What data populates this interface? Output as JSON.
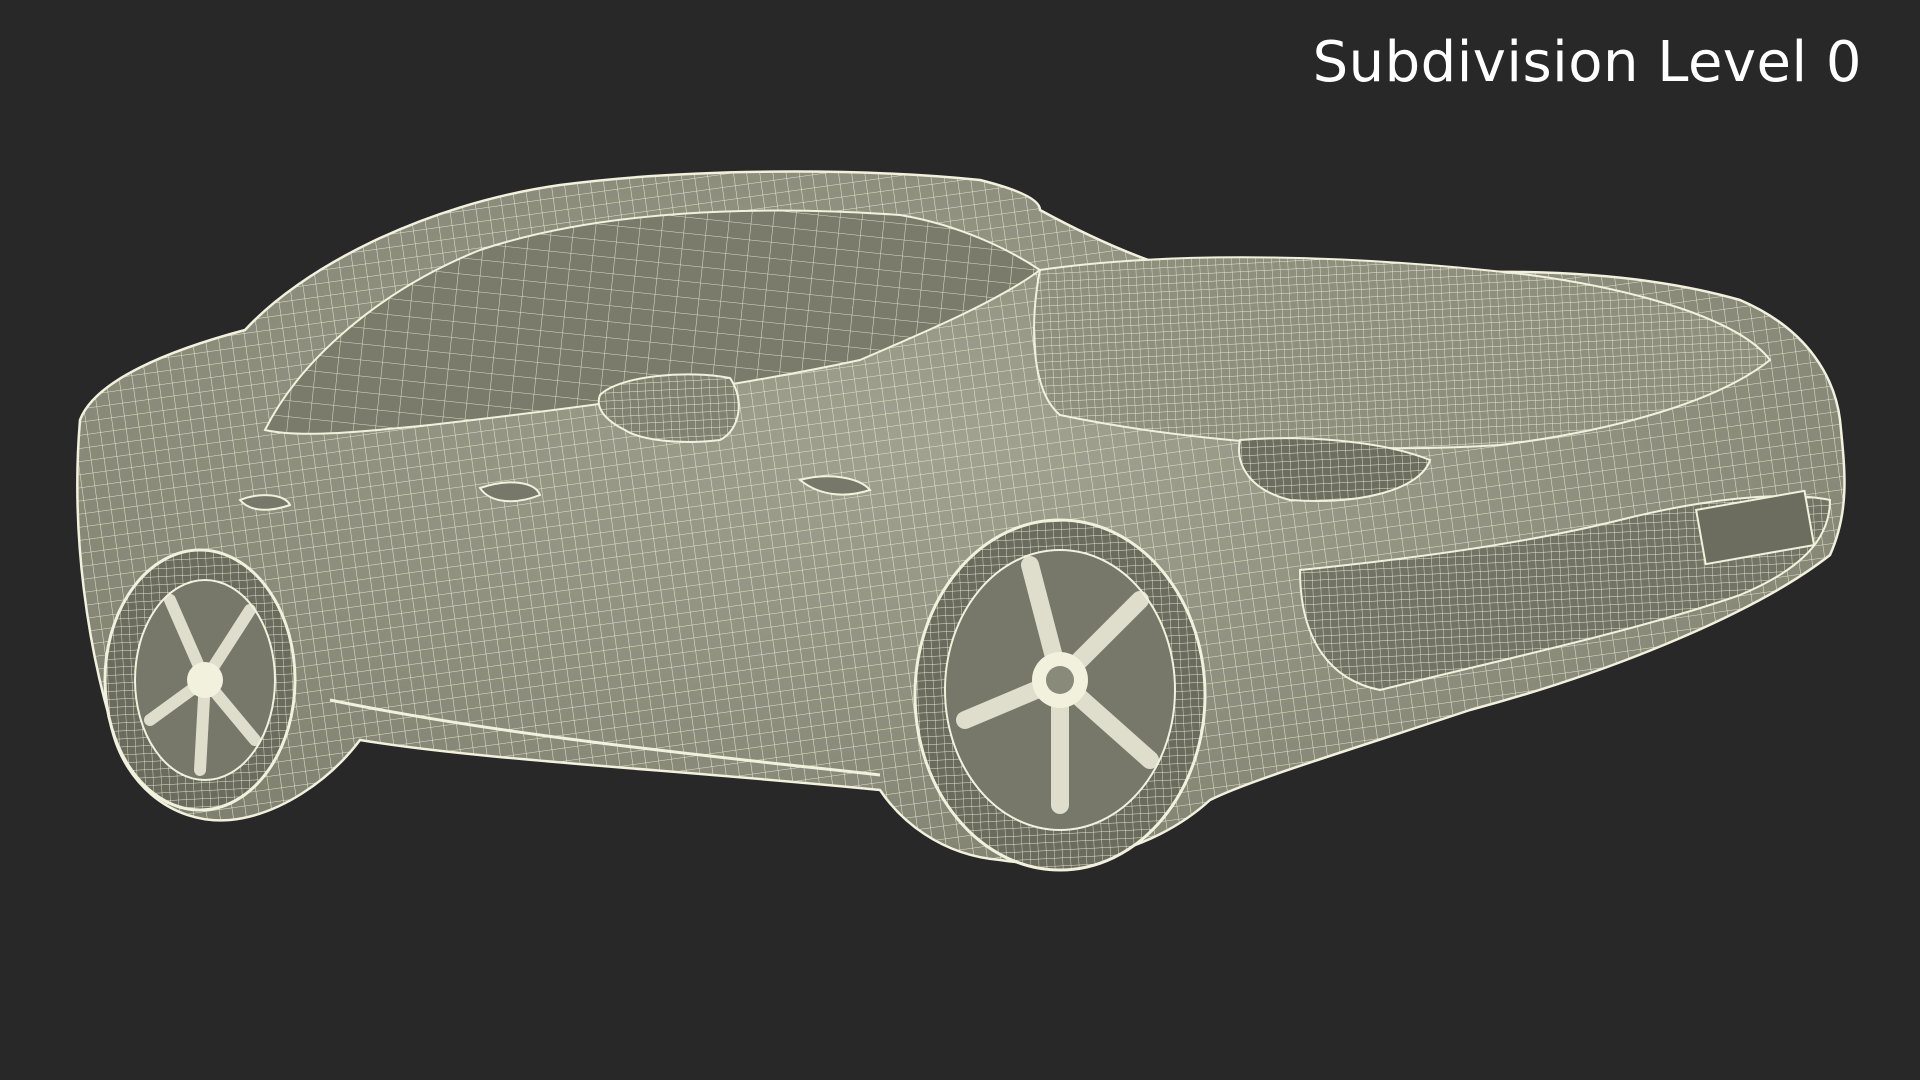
{
  "viewport": {
    "background_color": "#282828",
    "label": "Subdivision Level 0"
  },
  "model": {
    "body_color": "#8b8b7a",
    "shadow_color": "#6f6f61",
    "wire_color": "#eeeed8"
  }
}
